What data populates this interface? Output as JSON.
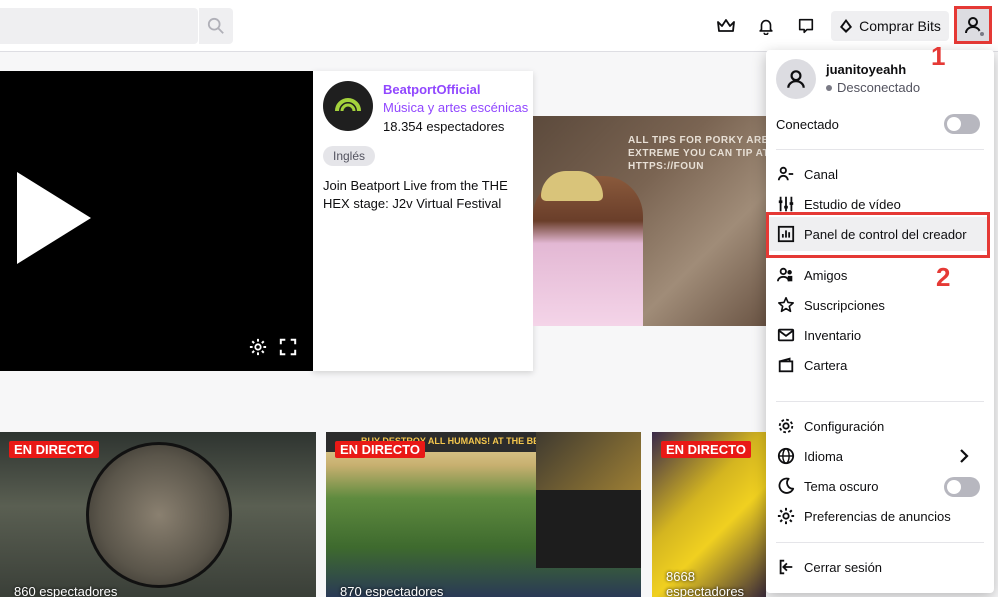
{
  "topbar": {
    "search_placeholder": "",
    "buy_bits_label": "Comprar Bits"
  },
  "featured": {
    "channel_name": "BeatportOfficial",
    "category": "Música y artes escénicas",
    "viewers": "18.354 espectadores",
    "tag": "Inglés",
    "description": "Join Beatport Live from the THE HEX stage: J2v Virtual Festival"
  },
  "side_stream": {
    "overlay_text": "ALL TIPS FOR PORKY ARE EXTREME YOU CAN TIP AT HTTPS://FOUN"
  },
  "live_cards": [
    {
      "badge": "EN DIRECTO",
      "viewers": "860 espectadores"
    },
    {
      "badge": "EN DIRECTO",
      "viewers": "870 espectadores",
      "promo": "BUY DESTROY ALL HUMANS! AT THE BEST PRICE"
    },
    {
      "badge": "EN DIRECTO",
      "viewers": "8668 espectadores"
    }
  ],
  "menu": {
    "username": "juanitoyeahh",
    "status": "Desconectado",
    "connected_label": "Conectado",
    "items": [
      {
        "label": "Canal",
        "icon": "channel-icon"
      },
      {
        "label": "Estudio de vídeo",
        "icon": "video-studio-icon"
      },
      {
        "label": "Panel de control del creador",
        "icon": "dashboard-icon"
      },
      {
        "label": "Amigos",
        "icon": "friends-icon"
      },
      {
        "label": "Suscripciones",
        "icon": "star-icon"
      },
      {
        "label": "Inventario",
        "icon": "inventory-icon"
      },
      {
        "label": "Cartera",
        "icon": "wallet-icon"
      },
      {
        "label": "Configuración",
        "icon": "gear-icon"
      },
      {
        "label": "Idioma",
        "icon": "globe-icon"
      },
      {
        "label": "Tema oscuro",
        "icon": "moon-icon"
      },
      {
        "label": "Preferencias de anuncios",
        "icon": "ad-preferences-icon"
      },
      {
        "label": "Cerrar sesión",
        "icon": "logout-icon"
      }
    ]
  },
  "annotations": {
    "step1": "1",
    "step2": "2"
  },
  "colors": {
    "accent": "#9147ff",
    "live": "#e91916",
    "annotation": "#e53935"
  }
}
